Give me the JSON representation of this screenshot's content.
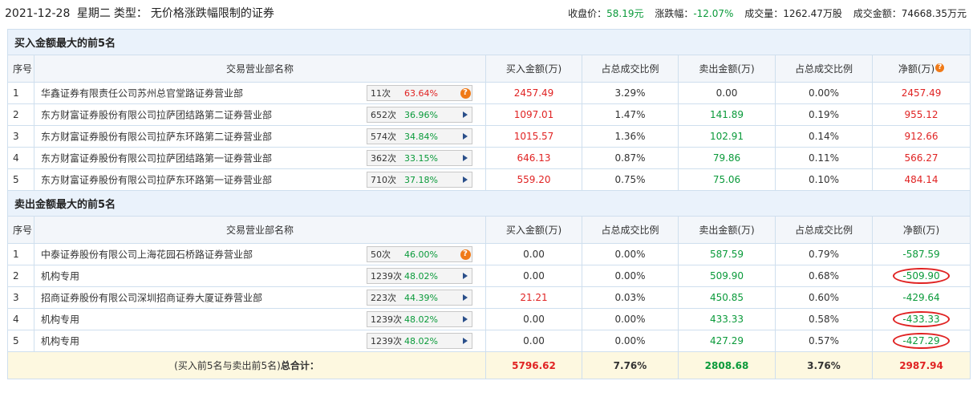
{
  "header": {
    "date": "2021-12-28",
    "weekday": "星期二",
    "type_label": "类型：",
    "type_value": "无价格涨跌幅限制的证券",
    "close_label": "收盘价：",
    "close_value": "58.19元",
    "change_label": "涨跌幅：",
    "change_value": "-12.07%",
    "volume_label": "成交量：",
    "volume_value": "1262.47万股",
    "amount_label": "成交金额：",
    "amount_value": "74668.35万元"
  },
  "columns": {
    "seq": "序号",
    "name": "交易营业部名称",
    "buy": "买入金额(万)",
    "buy_ratio": "占总成交比例",
    "sell": "卖出金额(万)",
    "sell_ratio": "占总成交比例",
    "net": "净额(万)"
  },
  "buy_section": {
    "title": "买入金额最大的前5名",
    "rows": [
      {
        "seq": "1",
        "name": "华鑫证券有限责任公司苏州总官堂路证券营业部",
        "count": "11次",
        "pct": "63.64%",
        "pct_color": "red",
        "icon": "question",
        "buy": "2457.49",
        "buy_ratio": "3.29%",
        "sell": "0.00",
        "sell_ratio": "0.00%",
        "net": "2457.49"
      },
      {
        "seq": "2",
        "name": "东方财富证券股份有限公司拉萨团结路第二证券营业部",
        "count": "652次",
        "pct": "36.96%",
        "pct_color": "green",
        "icon": "arrow",
        "buy": "1097.01",
        "buy_ratio": "1.47%",
        "sell": "141.89",
        "sell_ratio": "0.19%",
        "net": "955.12"
      },
      {
        "seq": "3",
        "name": "东方财富证券股份有限公司拉萨东环路第二证券营业部",
        "count": "574次",
        "pct": "34.84%",
        "pct_color": "green",
        "icon": "arrow",
        "buy": "1015.57",
        "buy_ratio": "1.36%",
        "sell": "102.91",
        "sell_ratio": "0.14%",
        "net": "912.66"
      },
      {
        "seq": "4",
        "name": "东方财富证券股份有限公司拉萨团结路第一证券营业部",
        "count": "362次",
        "pct": "33.15%",
        "pct_color": "green",
        "icon": "arrow",
        "buy": "646.13",
        "buy_ratio": "0.87%",
        "sell": "79.86",
        "sell_ratio": "0.11%",
        "net": "566.27"
      },
      {
        "seq": "5",
        "name": "东方财富证券股份有限公司拉萨东环路第一证券营业部",
        "count": "710次",
        "pct": "37.18%",
        "pct_color": "green",
        "icon": "arrow",
        "buy": "559.20",
        "buy_ratio": "0.75%",
        "sell": "75.06",
        "sell_ratio": "0.10%",
        "net": "484.14"
      }
    ]
  },
  "sell_section": {
    "title": "卖出金额最大的前5名",
    "rows": [
      {
        "seq": "1",
        "name": "中泰证券股份有限公司上海花园石桥路证券营业部",
        "count": "50次",
        "pct": "46.00%",
        "pct_color": "green",
        "icon": "question",
        "buy": "0.00",
        "buy_ratio": "0.00%",
        "sell": "587.59",
        "sell_ratio": "0.79%",
        "net": "-587.59",
        "circled": false
      },
      {
        "seq": "2",
        "name": "机构专用",
        "count": "1239次",
        "pct": "48.02%",
        "pct_color": "green",
        "icon": "arrow",
        "buy": "0.00",
        "buy_ratio": "0.00%",
        "sell": "509.90",
        "sell_ratio": "0.68%",
        "net": "-509.90",
        "circled": true
      },
      {
        "seq": "3",
        "name": "招商证券股份有限公司深圳招商证券大厦证券营业部",
        "count": "223次",
        "pct": "44.39%",
        "pct_color": "green",
        "icon": "arrow",
        "buy": "21.21",
        "buy_ratio": "0.03%",
        "sell": "450.85",
        "sell_ratio": "0.60%",
        "net": "-429.64",
        "circled": false
      },
      {
        "seq": "4",
        "name": "机构专用",
        "count": "1239次",
        "pct": "48.02%",
        "pct_color": "green",
        "icon": "arrow",
        "buy": "0.00",
        "buy_ratio": "0.00%",
        "sell": "433.33",
        "sell_ratio": "0.58%",
        "net": "-433.33",
        "circled": true
      },
      {
        "seq": "5",
        "name": "机构专用",
        "count": "1239次",
        "pct": "48.02%",
        "pct_color": "green",
        "icon": "arrow",
        "buy": "0.00",
        "buy_ratio": "0.00%",
        "sell": "427.29",
        "sell_ratio": "0.57%",
        "net": "-427.29",
        "circled": true
      }
    ]
  },
  "total": {
    "label_prefix": "(买入前5名与卖出前5名)",
    "label_bold": "总合计：",
    "buy": "5796.62",
    "buy_ratio": "7.76%",
    "sell": "2808.68",
    "sell_ratio": "3.76%",
    "net": "2987.94"
  },
  "colors": {
    "red": "#e02323",
    "green": "#0a9a3a",
    "section_bg": "#eaf2fb",
    "total_bg": "#fdf8e0",
    "border": "#cfdfee"
  }
}
